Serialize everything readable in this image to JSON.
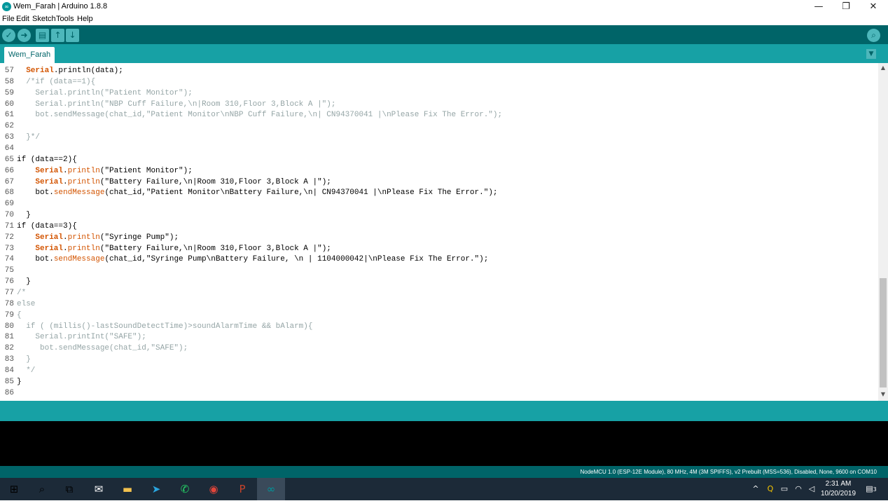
{
  "window": {
    "title": "Wem_Farah | Arduino 1.8.8",
    "app_icon": "∞",
    "minimize": "—",
    "maximize": "❐",
    "close": "✕"
  },
  "menu": [
    "File",
    "Edit",
    "Sketch",
    "Tools",
    "Help"
  ],
  "toolbar": {
    "verify": "✓",
    "upload": "➜",
    "new": "▤",
    "open": "↑",
    "save": "↓",
    "serial_monitor": "⌕"
  },
  "tab": {
    "label": "Wem_Farah",
    "menu_icon": "▼"
  },
  "code_lines": [
    {
      "n": "57",
      "segs": [
        {
          "t": "  "
        },
        {
          "t": "Serial",
          "c": "k"
        },
        {
          "t": ".println(data);"
        }
      ]
    },
    {
      "n": "58",
      "segs": [
        {
          "t": "  /*if (data==1){",
          "c": "c"
        }
      ]
    },
    {
      "n": "59",
      "segs": [
        {
          "t": "    Serial.println(\"Patient Monitor\");",
          "c": "c"
        }
      ]
    },
    {
      "n": "60",
      "segs": [
        {
          "t": "    Serial.println(\"NBP Cuff Failure,\\n|Room 310,Floor 3,Block A |\");",
          "c": "c"
        }
      ]
    },
    {
      "n": "61",
      "segs": [
        {
          "t": "    bot.sendMessage(chat_id,\"Patient Monitor\\nNBP Cuff Failure,\\n| CN94370041 |\\nPlease Fix The Error.\");",
          "c": "c"
        }
      ]
    },
    {
      "n": "62",
      "segs": [
        {
          "t": ""
        }
      ]
    },
    {
      "n": "63",
      "segs": [
        {
          "t": "  }*/",
          "c": "c"
        }
      ]
    },
    {
      "n": "64",
      "segs": [
        {
          "t": ""
        }
      ]
    },
    {
      "n": "65",
      "segs": [
        {
          "t": "if (data==2){"
        }
      ]
    },
    {
      "n": "66",
      "segs": [
        {
          "t": "    "
        },
        {
          "t": "Serial",
          "c": "k"
        },
        {
          "t": "."
        },
        {
          "t": "println",
          "c": "f"
        },
        {
          "t": "(\"Patient Monitor\");"
        }
      ]
    },
    {
      "n": "67",
      "segs": [
        {
          "t": "    "
        },
        {
          "t": "Serial",
          "c": "k"
        },
        {
          "t": "."
        },
        {
          "t": "println",
          "c": "f"
        },
        {
          "t": "(\"Battery Failure,\\n|Room 310,Floor 3,Block A |\");"
        }
      ]
    },
    {
      "n": "68",
      "segs": [
        {
          "t": "    bot."
        },
        {
          "t": "sendMessage",
          "c": "f"
        },
        {
          "t": "(chat_id,\"Patient Monitor\\nBattery Failure,\\n| CN94370041 |\\nPlease Fix The Error.\");"
        }
      ]
    },
    {
      "n": "69",
      "segs": [
        {
          "t": ""
        }
      ]
    },
    {
      "n": "70",
      "segs": [
        {
          "t": "  }"
        }
      ]
    },
    {
      "n": "71",
      "segs": [
        {
          "t": "if (data==3){"
        }
      ]
    },
    {
      "n": "72",
      "segs": [
        {
          "t": "    "
        },
        {
          "t": "Serial",
          "c": "k"
        },
        {
          "t": "."
        },
        {
          "t": "println",
          "c": "f"
        },
        {
          "t": "(\"Syringe Pump\");"
        }
      ]
    },
    {
      "n": "73",
      "segs": [
        {
          "t": "    "
        },
        {
          "t": "Serial",
          "c": "k"
        },
        {
          "t": "."
        },
        {
          "t": "println",
          "c": "f"
        },
        {
          "t": "(\"Battery Failure,\\n|Room 310,Floor 3,Block A |\");"
        }
      ]
    },
    {
      "n": "74",
      "segs": [
        {
          "t": "    bot."
        },
        {
          "t": "sendMessage",
          "c": "f"
        },
        {
          "t": "(chat_id,\"Syringe Pump\\nBattery Failure, \\n | 1104000042|\\nPlease Fix The Error.\");"
        }
      ]
    },
    {
      "n": "75",
      "segs": [
        {
          "t": ""
        }
      ]
    },
    {
      "n": "76",
      "segs": [
        {
          "t": "  }"
        }
      ]
    },
    {
      "n": "77",
      "segs": [
        {
          "t": "/*",
          "c": "c"
        }
      ]
    },
    {
      "n": "78",
      "segs": [
        {
          "t": "else",
          "c": "c"
        }
      ]
    },
    {
      "n": "79",
      "segs": [
        {
          "t": "{",
          "c": "c"
        }
      ]
    },
    {
      "n": "80",
      "segs": [
        {
          "t": "  if ( (millis()-lastSoundDetectTime)>soundAlarmTime && bAlarm){",
          "c": "c"
        }
      ]
    },
    {
      "n": "81",
      "segs": [
        {
          "t": "    Serial.printInt(\"SAFE\");",
          "c": "c"
        }
      ]
    },
    {
      "n": "82",
      "segs": [
        {
          "t": "     bot.sendMessage(chat_id,\"SAFE\");",
          "c": "c"
        }
      ]
    },
    {
      "n": "83",
      "segs": [
        {
          "t": "  }",
          "c": "c"
        }
      ]
    },
    {
      "n": "84",
      "segs": [
        {
          "t": "  */",
          "c": "c"
        }
      ]
    },
    {
      "n": "85",
      "segs": [
        {
          "t": "}"
        }
      ]
    },
    {
      "n": "86",
      "segs": [
        {
          "t": ""
        }
      ]
    }
  ],
  "board_status": "NodeMCU 1.0 (ESP-12E Module), 80 MHz, 4M (3M SPIFFS), v2 Prebuilt (MSS=536), Disabled, None, 9600 on COM10",
  "taskbar": {
    "start_icon": "⊞",
    "search_icon": "⌕",
    "taskview_icon": "⧉",
    "apps": [
      {
        "name": "mail-app-icon",
        "glyph": "✉"
      },
      {
        "name": "file-explorer-icon",
        "glyph": "▬"
      },
      {
        "name": "telegram-icon",
        "glyph": "➤"
      },
      {
        "name": "whatsapp-icon",
        "glyph": "✆"
      },
      {
        "name": "chrome-icon",
        "glyph": "◉"
      },
      {
        "name": "powerpoint-icon",
        "glyph": "P"
      },
      {
        "name": "arduino-icon",
        "glyph": "∞"
      }
    ],
    "tray": {
      "chevron": "^",
      "battery": "▭",
      "wifi": "◠",
      "volume": "◁",
      "time": "2:31 AM",
      "date": "10/20/2019",
      "notifications_count": "3"
    }
  },
  "colors": {
    "toolbar": "#006468",
    "tabbar": "#17a1a5",
    "keyword": "#d35400",
    "comment": "#95a5a6"
  }
}
